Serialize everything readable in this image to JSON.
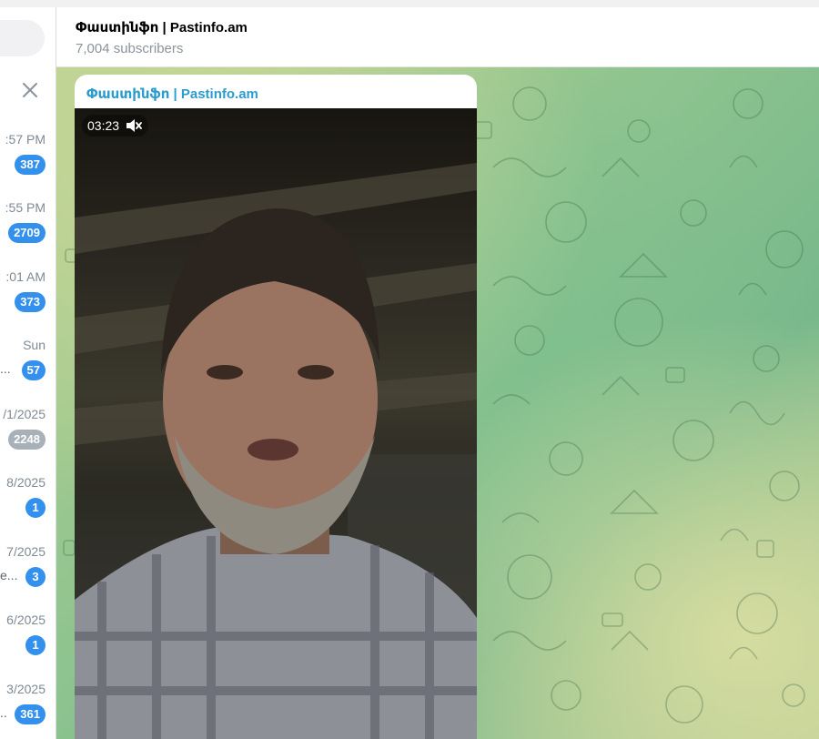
{
  "header": {
    "title": "Փաստինֆո | Pastinfo.am",
    "subtitle": "7,004 subscribers"
  },
  "sidebar": {
    "close_icon": "close-icon",
    "chats": [
      {
        "time": ":57 PM",
        "snippet": "",
        "badge": "387",
        "muted": false
      },
      {
        "time": ":55 PM",
        "snippet": "",
        "badge": "2709",
        "muted": false
      },
      {
        "time": ":01 AM",
        "snippet": "",
        "badge": "373",
        "muted": false
      },
      {
        "time": "Sun",
        "snippet": "...",
        "badge": "57",
        "muted": false
      },
      {
        "time": "/1/2025",
        "snippet": "",
        "badge": "2248",
        "muted": true
      },
      {
        "time": "8/2025",
        "snippet": "",
        "badge": "1",
        "muted": false
      },
      {
        "time": "7/2025",
        "snippet": "e...",
        "badge": "3",
        "muted": false
      },
      {
        "time": "6/2025",
        "snippet": "",
        "badge": "1",
        "muted": false
      },
      {
        "time": "3/2025",
        "snippet": "..",
        "badge": "361",
        "muted": false
      }
    ]
  },
  "message": {
    "author": "Փաստինֆո | Pastinfo.am",
    "video": {
      "duration": "03:23",
      "mute_icon": "muted-speaker-icon"
    }
  },
  "colors": {
    "accent": "#3390ec",
    "author": "#2c9ccd",
    "muted_badge": "#a8b0b8"
  }
}
